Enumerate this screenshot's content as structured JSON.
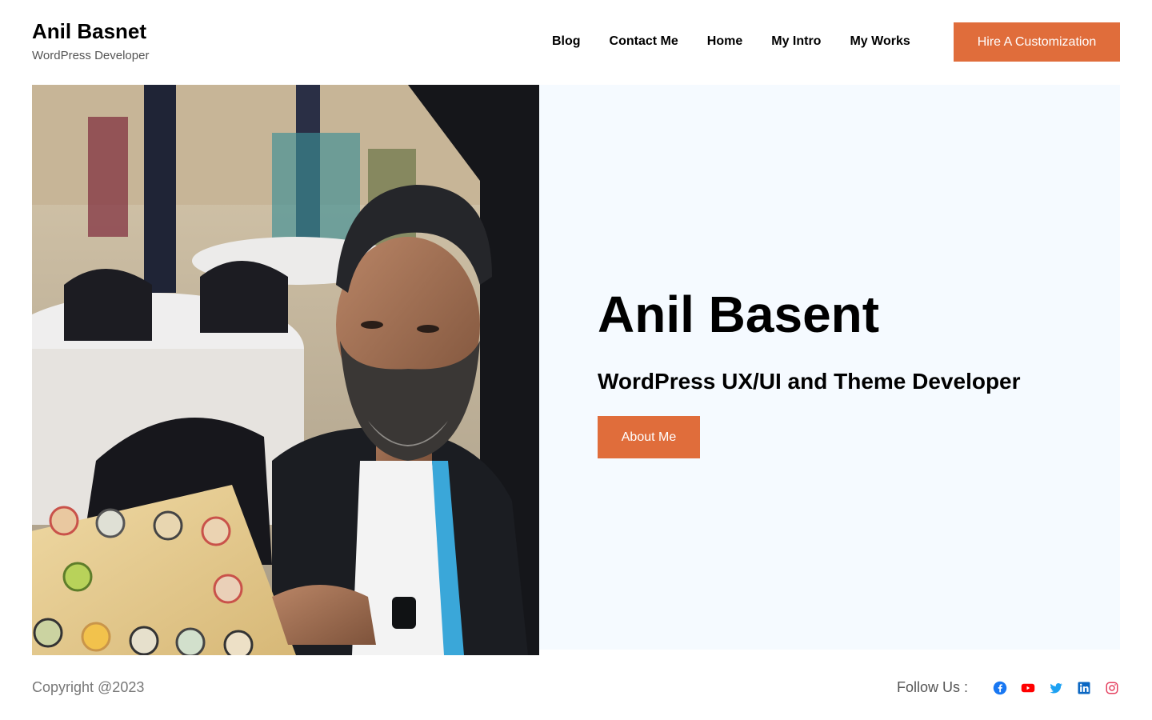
{
  "header": {
    "site_title": "Anil Basnet",
    "tagline": "WordPress Developer",
    "nav": [
      {
        "label": "Blog"
      },
      {
        "label": "Contact Me"
      },
      {
        "label": "Home"
      },
      {
        "label": "My Intro"
      },
      {
        "label": "My Works"
      }
    ],
    "cta_label": "Hire A Customization"
  },
  "hero": {
    "name": "Anil Basent",
    "subtitle": "WordPress UX/UI and Theme Developer",
    "button_label": "About Me"
  },
  "footer": {
    "copyright": "Copyright @2023",
    "follow_label": "Follow Us :",
    "social": [
      {
        "icon": "facebook-icon",
        "color": "#1877f2"
      },
      {
        "icon": "youtube-icon",
        "color": "#ff0000"
      },
      {
        "icon": "twitter-icon",
        "color": "#1da1f2"
      },
      {
        "icon": "linkedin-icon",
        "color": "#0a66c2"
      },
      {
        "icon": "instagram-icon",
        "color": "#e4405f"
      }
    ]
  },
  "colors": {
    "accent": "#e06d3b",
    "hero_panel_bg": "#f5faff"
  }
}
